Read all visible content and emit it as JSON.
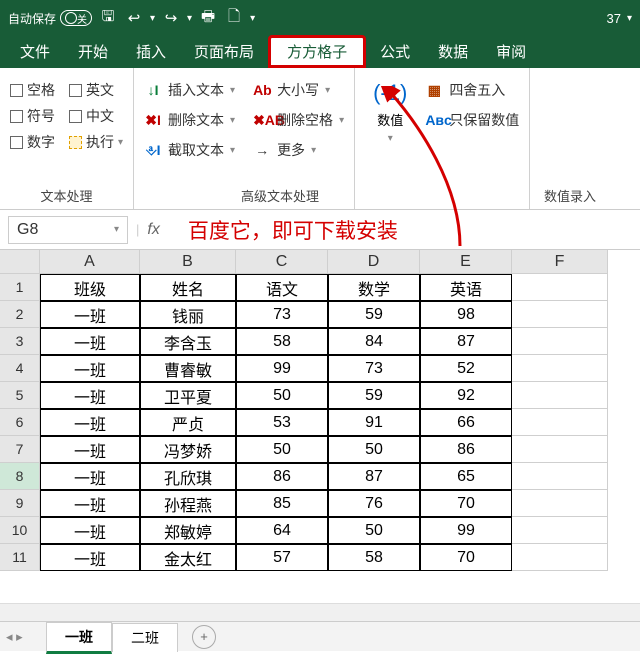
{
  "titlebar": {
    "autosave_label": "自动保存",
    "autosave_state": "关",
    "page_count": "37"
  },
  "tabs": [
    "文件",
    "开始",
    "插入",
    "页面布局",
    "方方格子",
    "公式",
    "数据",
    "审阅"
  ],
  "ribbon": {
    "group_text": {
      "label": "文本处理",
      "items": [
        "空格",
        "英文",
        "符号",
        "中文",
        "数字",
        "执行"
      ]
    },
    "group_adv": {
      "label": "高级文本处理",
      "left": [
        "插入文本",
        "删除文本",
        "截取文本"
      ],
      "right": [
        "大小写",
        "删除空格",
        "更多"
      ]
    },
    "group_num": {
      "label": "数值录入",
      "big": "数值",
      "items": [
        "四舍五入",
        "只保留数值"
      ]
    }
  },
  "formula": {
    "namebox": "G8"
  },
  "annotation": "百度它，即可下载安装",
  "sheet": {
    "columns": [
      "A",
      "B",
      "C",
      "D",
      "E",
      "F"
    ],
    "headers": [
      "班级",
      "姓名",
      "语文",
      "数学",
      "英语"
    ],
    "rows": [
      [
        "一班",
        "钱丽",
        "73",
        "59",
        "98"
      ],
      [
        "一班",
        "李含玉",
        "58",
        "84",
        "87"
      ],
      [
        "一班",
        "曹睿敏",
        "99",
        "73",
        "52"
      ],
      [
        "一班",
        "卫平夏",
        "50",
        "59",
        "92"
      ],
      [
        "一班",
        "严贞",
        "53",
        "91",
        "66"
      ],
      [
        "一班",
        "冯梦娇",
        "50",
        "50",
        "86"
      ],
      [
        "一班",
        "孔欣琪",
        "86",
        "87",
        "65"
      ],
      [
        "一班",
        "孙程燕",
        "85",
        "76",
        "70"
      ],
      [
        "一班",
        "郑敏婷",
        "64",
        "50",
        "99"
      ],
      [
        "一班",
        "金太红",
        "57",
        "58",
        "70"
      ]
    ],
    "tabs": [
      "一班",
      "二班"
    ]
  }
}
